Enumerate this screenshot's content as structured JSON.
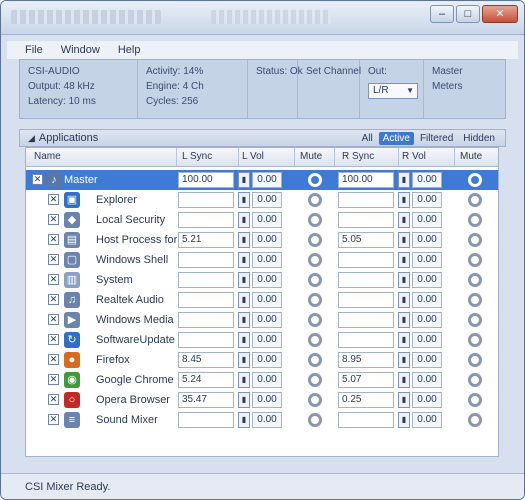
{
  "menu": [
    "File",
    "Window",
    "Help"
  ],
  "info": {
    "col1": [
      "CSI-AUDIO",
      "Output: 48 kHz",
      "Latency: 10 ms"
    ],
    "col2": [
      "Activity: 14%",
      "Engine: 4 Ch",
      "Cycles: 256"
    ],
    "col3": [
      "Status: Ok"
    ],
    "col4": [
      "Set Channel"
    ],
    "out_label": "Out:",
    "out_value": "L/R",
    "col6": [
      "Master",
      "Meters"
    ]
  },
  "section": {
    "title": "Applications",
    "tabs": [
      "All",
      "Active",
      "Filtered",
      "Hidden"
    ],
    "active_tab": "Active"
  },
  "columns": [
    "Name",
    "L Sync",
    "L Vol",
    "Mute",
    "R Sync",
    "R Vol",
    "Mute"
  ],
  "rows": [
    {
      "name": "Master",
      "l": "100.00",
      "lv": "0.00",
      "r": "100.00",
      "rv": "0.00",
      "icon": "speaker-icon",
      "color": "#5a76a8",
      "master": true,
      "selected": true
    },
    {
      "name": "Explorer",
      "l": "",
      "lv": "0.00",
      "r": "",
      "rv": "0.00",
      "icon": "explorer-icon",
      "color": "#2f6fc7"
    },
    {
      "name": "Local Security",
      "l": "",
      "lv": "0.00",
      "r": "",
      "rv": "0.00",
      "icon": "shield-icon",
      "color": "#6b84ad"
    },
    {
      "name": "Host Process for W",
      "l": "5.21",
      "lv": "0.00",
      "r": "5.05",
      "rv": "0.00",
      "icon": "process-icon",
      "color": "#6b84ad"
    },
    {
      "name": "Windows Shell",
      "l": "",
      "lv": "0.00",
      "r": "",
      "rv": "0.00",
      "icon": "window-icon",
      "color": "#6b84ad"
    },
    {
      "name": "System",
      "l": "",
      "lv": "0.00",
      "r": "",
      "rv": "0.00",
      "icon": "system-icon",
      "color": "#8aa0c2"
    },
    {
      "name": "Realtek Audio",
      "l": "",
      "lv": "0.00",
      "r": "",
      "rv": "0.00",
      "icon": "audio-icon",
      "color": "#6b84ad"
    },
    {
      "name": "Windows Media",
      "l": "",
      "lv": "0.00",
      "r": "",
      "rv": "0.00",
      "icon": "media-icon",
      "color": "#6b84ad"
    },
    {
      "name": "SoftwareUpdate",
      "l": "",
      "lv": "0.00",
      "r": "",
      "rv": "0.00",
      "icon": "update-icon",
      "color": "#2f6fc7"
    },
    {
      "name": "Firefox",
      "l": "8.45",
      "lv": "0.00",
      "r": "8.95",
      "rv": "0.00",
      "icon": "firefox-icon",
      "color": "#d86a1f"
    },
    {
      "name": "Google Chrome",
      "l": "5.24",
      "lv": "0.00",
      "r": "5.07",
      "rv": "0.00",
      "icon": "chrome-icon",
      "color": "#3f9a3a"
    },
    {
      "name": "Opera Browser",
      "l": "35.47",
      "lv": "0.00",
      "r": "0.25",
      "rv": "0.00",
      "icon": "opera-icon",
      "color": "#c22a2a"
    },
    {
      "name": "Sound Mixer",
      "l": "",
      "lv": "0.00",
      "r": "",
      "rv": "0.00",
      "icon": "mixer-icon",
      "color": "#6b84ad"
    }
  ],
  "status": "CSI Mixer Ready."
}
